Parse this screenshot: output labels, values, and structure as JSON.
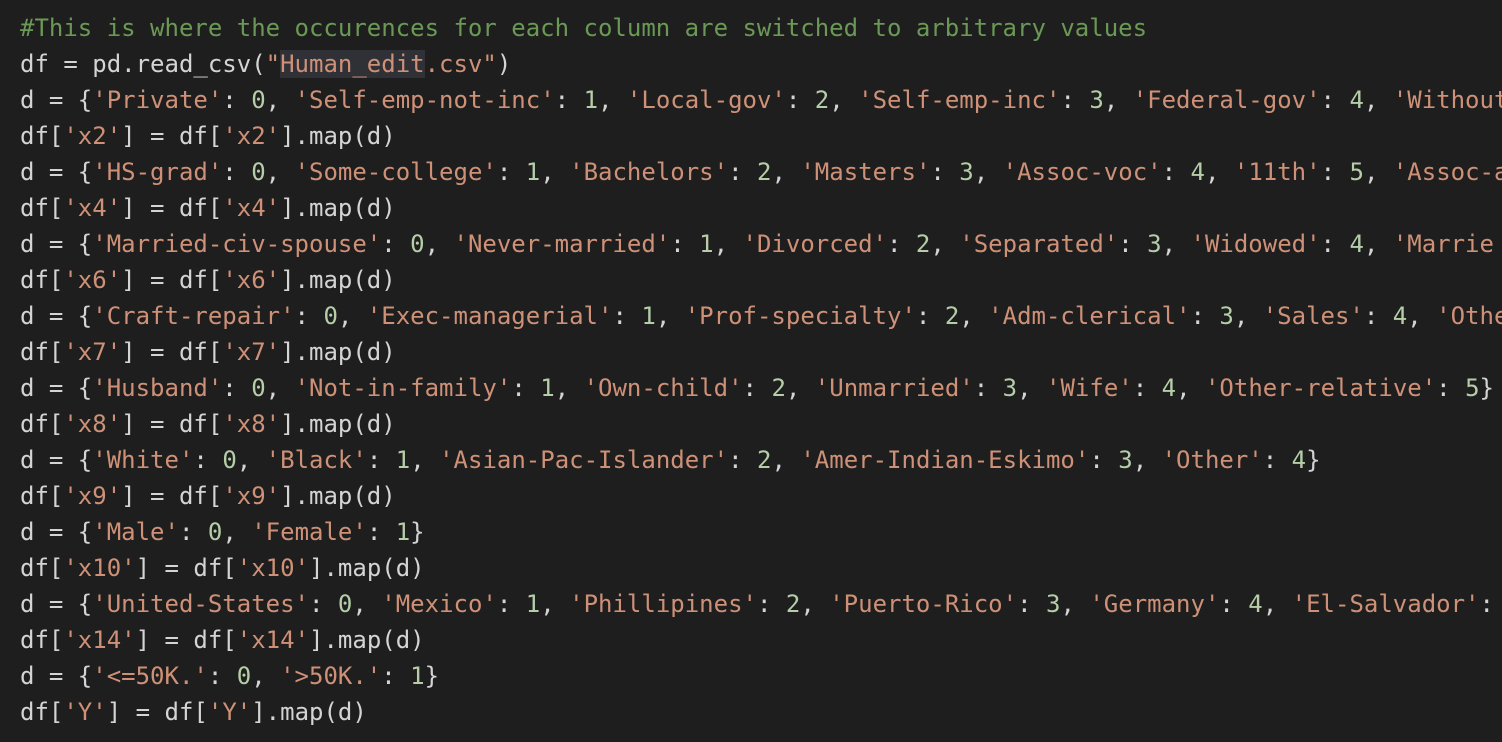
{
  "editor": {
    "lines": [
      {
        "tokens": [
          {
            "t": "cm",
            "v": "#This is where the occurences for each column are switched to arbitrary values"
          }
        ]
      },
      {
        "tokens": [
          {
            "t": "pl",
            "v": "df = pd.read_csv("
          },
          {
            "t": "st",
            "v": "\""
          },
          {
            "t": "st",
            "v": "Human_edit",
            "hl": true
          },
          {
            "t": "st",
            "v": ".csv\""
          },
          {
            "t": "pl",
            "v": ")"
          }
        ]
      },
      {
        "tokens": [
          {
            "t": "pl",
            "v": "d = {"
          },
          {
            "t": "st",
            "v": "'Private'"
          },
          {
            "t": "pl",
            "v": ": "
          },
          {
            "t": "nu",
            "v": "0"
          },
          {
            "t": "pl",
            "v": ", "
          },
          {
            "t": "st",
            "v": "'Self-emp-not-inc'"
          },
          {
            "t": "pl",
            "v": ": "
          },
          {
            "t": "nu",
            "v": "1"
          },
          {
            "t": "pl",
            "v": ", "
          },
          {
            "t": "st",
            "v": "'Local-gov'"
          },
          {
            "t": "pl",
            "v": ": "
          },
          {
            "t": "nu",
            "v": "2"
          },
          {
            "t": "pl",
            "v": ", "
          },
          {
            "t": "st",
            "v": "'Self-emp-inc'"
          },
          {
            "t": "pl",
            "v": ": "
          },
          {
            "t": "nu",
            "v": "3"
          },
          {
            "t": "pl",
            "v": ", "
          },
          {
            "t": "st",
            "v": "'Federal-gov'"
          },
          {
            "t": "pl",
            "v": ": "
          },
          {
            "t": "nu",
            "v": "4"
          },
          {
            "t": "pl",
            "v": ", "
          },
          {
            "t": "st",
            "v": "'Without"
          }
        ]
      },
      {
        "tokens": [
          {
            "t": "pl",
            "v": "df["
          },
          {
            "t": "st",
            "v": "'x2'"
          },
          {
            "t": "pl",
            "v": "] = df["
          },
          {
            "t": "st",
            "v": "'x2'"
          },
          {
            "t": "pl",
            "v": "].map(d)"
          }
        ]
      },
      {
        "tokens": [
          {
            "t": "pl",
            "v": "d = {"
          },
          {
            "t": "st",
            "v": "'HS-grad'"
          },
          {
            "t": "pl",
            "v": ": "
          },
          {
            "t": "nu",
            "v": "0"
          },
          {
            "t": "pl",
            "v": ", "
          },
          {
            "t": "st",
            "v": "'Some-college'"
          },
          {
            "t": "pl",
            "v": ": "
          },
          {
            "t": "nu",
            "v": "1"
          },
          {
            "t": "pl",
            "v": ", "
          },
          {
            "t": "st",
            "v": "'Bachelors'"
          },
          {
            "t": "pl",
            "v": ": "
          },
          {
            "t": "nu",
            "v": "2"
          },
          {
            "t": "pl",
            "v": ", "
          },
          {
            "t": "st",
            "v": "'Masters'"
          },
          {
            "t": "pl",
            "v": ": "
          },
          {
            "t": "nu",
            "v": "3"
          },
          {
            "t": "pl",
            "v": ", "
          },
          {
            "t": "st",
            "v": "'Assoc-voc'"
          },
          {
            "t": "pl",
            "v": ": "
          },
          {
            "t": "nu",
            "v": "4"
          },
          {
            "t": "pl",
            "v": ", "
          },
          {
            "t": "st",
            "v": "'11th'"
          },
          {
            "t": "pl",
            "v": ": "
          },
          {
            "t": "nu",
            "v": "5"
          },
          {
            "t": "pl",
            "v": ", "
          },
          {
            "t": "st",
            "v": "'Assoc-a"
          }
        ]
      },
      {
        "tokens": [
          {
            "t": "pl",
            "v": "df["
          },
          {
            "t": "st",
            "v": "'x4'"
          },
          {
            "t": "pl",
            "v": "] = df["
          },
          {
            "t": "st",
            "v": "'x4'"
          },
          {
            "t": "pl",
            "v": "].map(d)"
          }
        ]
      },
      {
        "tokens": [
          {
            "t": "pl",
            "v": "d = {"
          },
          {
            "t": "st",
            "v": "'Married-civ-spouse'"
          },
          {
            "t": "pl",
            "v": ": "
          },
          {
            "t": "nu",
            "v": "0"
          },
          {
            "t": "pl",
            "v": ", "
          },
          {
            "t": "st",
            "v": "'Never-married'"
          },
          {
            "t": "pl",
            "v": ": "
          },
          {
            "t": "nu",
            "v": "1"
          },
          {
            "t": "pl",
            "v": ", "
          },
          {
            "t": "st",
            "v": "'Divorced'"
          },
          {
            "t": "pl",
            "v": ": "
          },
          {
            "t": "nu",
            "v": "2"
          },
          {
            "t": "pl",
            "v": ", "
          },
          {
            "t": "st",
            "v": "'Separated'"
          },
          {
            "t": "pl",
            "v": ": "
          },
          {
            "t": "nu",
            "v": "3"
          },
          {
            "t": "pl",
            "v": ", "
          },
          {
            "t": "st",
            "v": "'Widowed'"
          },
          {
            "t": "pl",
            "v": ": "
          },
          {
            "t": "nu",
            "v": "4"
          },
          {
            "t": "pl",
            "v": ", "
          },
          {
            "t": "st",
            "v": "'Marrie"
          }
        ]
      },
      {
        "tokens": [
          {
            "t": "pl",
            "v": "df["
          },
          {
            "t": "st",
            "v": "'x6'"
          },
          {
            "t": "pl",
            "v": "] = df["
          },
          {
            "t": "st",
            "v": "'x6'"
          },
          {
            "t": "pl",
            "v": "].map(d)"
          }
        ]
      },
      {
        "tokens": [
          {
            "t": "pl",
            "v": "d = {"
          },
          {
            "t": "st",
            "v": "'Craft-repair'"
          },
          {
            "t": "pl",
            "v": ": "
          },
          {
            "t": "nu",
            "v": "0"
          },
          {
            "t": "pl",
            "v": ", "
          },
          {
            "t": "st",
            "v": "'Exec-managerial'"
          },
          {
            "t": "pl",
            "v": ": "
          },
          {
            "t": "nu",
            "v": "1"
          },
          {
            "t": "pl",
            "v": ", "
          },
          {
            "t": "st",
            "v": "'Prof-specialty'"
          },
          {
            "t": "pl",
            "v": ": "
          },
          {
            "t": "nu",
            "v": "2"
          },
          {
            "t": "pl",
            "v": ", "
          },
          {
            "t": "st",
            "v": "'Adm-clerical'"
          },
          {
            "t": "pl",
            "v": ": "
          },
          {
            "t": "nu",
            "v": "3"
          },
          {
            "t": "pl",
            "v": ", "
          },
          {
            "t": "st",
            "v": "'Sales'"
          },
          {
            "t": "pl",
            "v": ": "
          },
          {
            "t": "nu",
            "v": "4"
          },
          {
            "t": "pl",
            "v": ", "
          },
          {
            "t": "st",
            "v": "'Othe"
          }
        ]
      },
      {
        "tokens": [
          {
            "t": "pl",
            "v": "df["
          },
          {
            "t": "st",
            "v": "'x7'"
          },
          {
            "t": "pl",
            "v": "] = df["
          },
          {
            "t": "st",
            "v": "'x7'"
          },
          {
            "t": "pl",
            "v": "].map(d)"
          }
        ]
      },
      {
        "tokens": [
          {
            "t": "pl",
            "v": "d = {"
          },
          {
            "t": "st",
            "v": "'Husband'"
          },
          {
            "t": "pl",
            "v": ": "
          },
          {
            "t": "nu",
            "v": "0"
          },
          {
            "t": "pl",
            "v": ", "
          },
          {
            "t": "st",
            "v": "'Not-in-family'"
          },
          {
            "t": "pl",
            "v": ": "
          },
          {
            "t": "nu",
            "v": "1"
          },
          {
            "t": "pl",
            "v": ", "
          },
          {
            "t": "st",
            "v": "'Own-child'"
          },
          {
            "t": "pl",
            "v": ": "
          },
          {
            "t": "nu",
            "v": "2"
          },
          {
            "t": "pl",
            "v": ", "
          },
          {
            "t": "st",
            "v": "'Unmarried'"
          },
          {
            "t": "pl",
            "v": ": "
          },
          {
            "t": "nu",
            "v": "3"
          },
          {
            "t": "pl",
            "v": ", "
          },
          {
            "t": "st",
            "v": "'Wife'"
          },
          {
            "t": "pl",
            "v": ": "
          },
          {
            "t": "nu",
            "v": "4"
          },
          {
            "t": "pl",
            "v": ", "
          },
          {
            "t": "st",
            "v": "'Other-relative'"
          },
          {
            "t": "pl",
            "v": ": "
          },
          {
            "t": "nu",
            "v": "5"
          },
          {
            "t": "pl",
            "v": "}"
          }
        ]
      },
      {
        "tokens": [
          {
            "t": "pl",
            "v": "df["
          },
          {
            "t": "st",
            "v": "'x8'"
          },
          {
            "t": "pl",
            "v": "] = df["
          },
          {
            "t": "st",
            "v": "'x8'"
          },
          {
            "t": "pl",
            "v": "].map(d)"
          }
        ]
      },
      {
        "tokens": [
          {
            "t": "pl",
            "v": "d = {"
          },
          {
            "t": "st",
            "v": "'White'"
          },
          {
            "t": "pl",
            "v": ": "
          },
          {
            "t": "nu",
            "v": "0"
          },
          {
            "t": "pl",
            "v": ", "
          },
          {
            "t": "st",
            "v": "'Black'"
          },
          {
            "t": "pl",
            "v": ": "
          },
          {
            "t": "nu",
            "v": "1"
          },
          {
            "t": "pl",
            "v": ", "
          },
          {
            "t": "st",
            "v": "'Asian-Pac-Islander'"
          },
          {
            "t": "pl",
            "v": ": "
          },
          {
            "t": "nu",
            "v": "2"
          },
          {
            "t": "pl",
            "v": ", "
          },
          {
            "t": "st",
            "v": "'Amer-Indian-Eskimo'"
          },
          {
            "t": "pl",
            "v": ": "
          },
          {
            "t": "nu",
            "v": "3"
          },
          {
            "t": "pl",
            "v": ", "
          },
          {
            "t": "st",
            "v": "'Other'"
          },
          {
            "t": "pl",
            "v": ": "
          },
          {
            "t": "nu",
            "v": "4"
          },
          {
            "t": "pl",
            "v": "}"
          }
        ]
      },
      {
        "tokens": [
          {
            "t": "pl",
            "v": "df["
          },
          {
            "t": "st",
            "v": "'x9'"
          },
          {
            "t": "pl",
            "v": "] = df["
          },
          {
            "t": "st",
            "v": "'x9'"
          },
          {
            "t": "pl",
            "v": "].map(d)"
          }
        ]
      },
      {
        "tokens": [
          {
            "t": "pl",
            "v": "d = {"
          },
          {
            "t": "st",
            "v": "'Male'"
          },
          {
            "t": "pl",
            "v": ": "
          },
          {
            "t": "nu",
            "v": "0"
          },
          {
            "t": "pl",
            "v": ", "
          },
          {
            "t": "st",
            "v": "'Female'"
          },
          {
            "t": "pl",
            "v": ": "
          },
          {
            "t": "nu",
            "v": "1"
          },
          {
            "t": "pl",
            "v": "}"
          }
        ]
      },
      {
        "tokens": [
          {
            "t": "pl",
            "v": "df["
          },
          {
            "t": "st",
            "v": "'x10'"
          },
          {
            "t": "pl",
            "v": "] = df["
          },
          {
            "t": "st",
            "v": "'x10'"
          },
          {
            "t": "pl",
            "v": "].map(d)"
          }
        ]
      },
      {
        "tokens": [
          {
            "t": "pl",
            "v": "d = {"
          },
          {
            "t": "st",
            "v": "'United-States'"
          },
          {
            "t": "pl",
            "v": ": "
          },
          {
            "t": "nu",
            "v": "0"
          },
          {
            "t": "pl",
            "v": ", "
          },
          {
            "t": "st",
            "v": "'Mexico'"
          },
          {
            "t": "pl",
            "v": ": "
          },
          {
            "t": "nu",
            "v": "1"
          },
          {
            "t": "pl",
            "v": ", "
          },
          {
            "t": "st",
            "v": "'Phillipines'"
          },
          {
            "t": "pl",
            "v": ": "
          },
          {
            "t": "nu",
            "v": "2"
          },
          {
            "t": "pl",
            "v": ", "
          },
          {
            "t": "st",
            "v": "'Puerto-Rico'"
          },
          {
            "t": "pl",
            "v": ": "
          },
          {
            "t": "nu",
            "v": "3"
          },
          {
            "t": "pl",
            "v": ", "
          },
          {
            "t": "st",
            "v": "'Germany'"
          },
          {
            "t": "pl",
            "v": ": "
          },
          {
            "t": "nu",
            "v": "4"
          },
          {
            "t": "pl",
            "v": ", "
          },
          {
            "t": "st",
            "v": "'El-Salvador'"
          },
          {
            "t": "pl",
            "v": ": "
          }
        ]
      },
      {
        "tokens": [
          {
            "t": "pl",
            "v": "df["
          },
          {
            "t": "st",
            "v": "'x14'"
          },
          {
            "t": "pl",
            "v": "] = df["
          },
          {
            "t": "st",
            "v": "'x14'"
          },
          {
            "t": "pl",
            "v": "].map(d)"
          }
        ]
      },
      {
        "tokens": [
          {
            "t": "pl",
            "v": "d = {"
          },
          {
            "t": "st",
            "v": "'<=50K.'"
          },
          {
            "t": "pl",
            "v": ": "
          },
          {
            "t": "nu",
            "v": "0"
          },
          {
            "t": "pl",
            "v": ", "
          },
          {
            "t": "st",
            "v": "'>50K.'"
          },
          {
            "t": "pl",
            "v": ": "
          },
          {
            "t": "nu",
            "v": "1"
          },
          {
            "t": "pl",
            "v": "}"
          }
        ]
      },
      {
        "tokens": [
          {
            "t": "pl",
            "v": "df["
          },
          {
            "t": "st",
            "v": "'Y'"
          },
          {
            "t": "pl",
            "v": "] = df["
          },
          {
            "t": "st",
            "v": "'Y'"
          },
          {
            "t": "pl",
            "v": "].map(d)"
          }
        ]
      }
    ]
  }
}
